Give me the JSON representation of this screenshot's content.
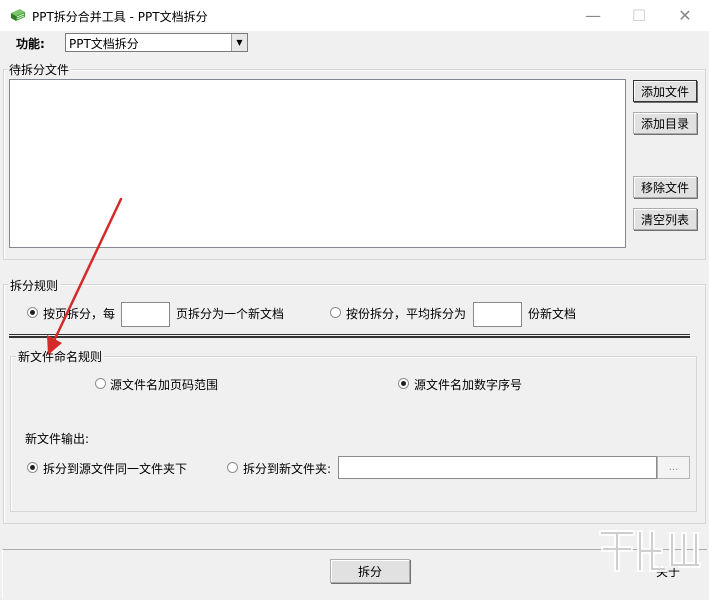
{
  "window": {
    "title": "PPT拆分合并工具 - PPT文档拆分",
    "min_icon": "minimize-icon",
    "max_icon": "maximize-icon",
    "close_icon": "close-icon"
  },
  "function_row": {
    "label": "功能:",
    "selected": "PPT文档拆分"
  },
  "files_group": {
    "title": "待拆分文件",
    "buttons": {
      "add_file": "添加文件",
      "add_dir": "添加目录",
      "remove_file": "移除文件",
      "clear_list": "清空列表"
    }
  },
  "split_rule": {
    "title": "拆分规则",
    "by_page_label": "按页拆分，每",
    "by_page_suffix": "页拆分为一个新文档",
    "by_page_value": "",
    "by_count_label": "按份拆分，平均拆分为",
    "by_count_suffix": "份新文档",
    "by_count_value": "",
    "selected": "by_page"
  },
  "naming_rule": {
    "title": "新文件命名规则",
    "page_range_label": "源文件名加页码范围",
    "num_seq_label": "源文件名加数字序号",
    "selected": "num_seq",
    "output_label": "新文件输出:",
    "same_folder_label": "拆分到源文件同一文件夹下",
    "new_folder_label": "拆分到新文件夹:",
    "output_selected": "same_folder",
    "folder_value": "",
    "browse_label": "..."
  },
  "bottom": {
    "split_button": "拆分",
    "about_label": "关于"
  },
  "colors": {
    "window_bg": "#f0f0f0",
    "arrow": "#d42a2a",
    "icon_green": "#3f9b2e"
  }
}
